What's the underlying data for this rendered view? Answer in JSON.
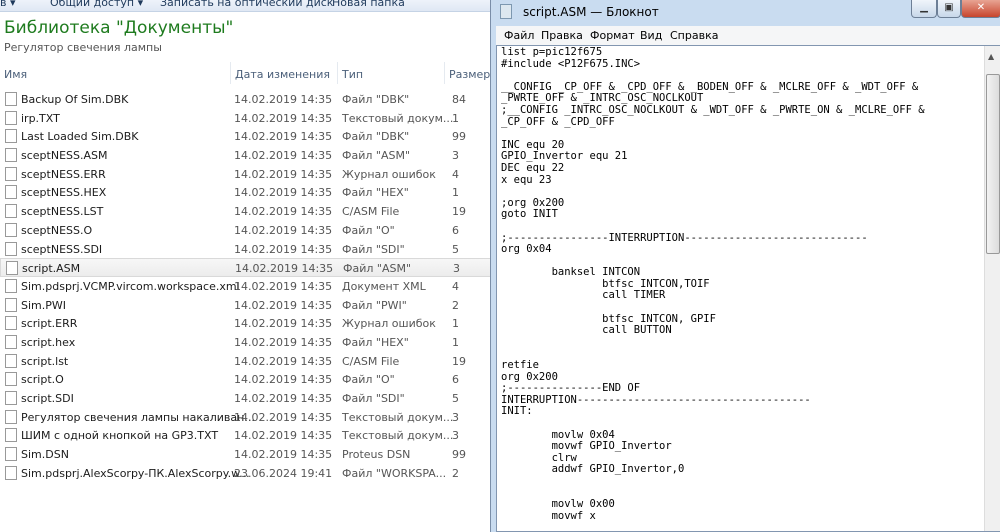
{
  "explorer": {
    "toolbar": [
      "в ▾",
      "Общий доступ ▾",
      "Записать на оптический диск",
      "Новая папка"
    ],
    "library_title": "Библиотека \"Документы\"",
    "subtitle": "Регулятор свечения лампы",
    "columns": {
      "name": "Имя",
      "date": "Дата изменения",
      "type": "Тип",
      "size": "Размер"
    },
    "files": [
      {
        "name": "Backup Of Sim.DBK",
        "date": "14.02.2019 14:35",
        "type": "Файл \"DBK\"",
        "size": "84",
        "icon": "file-icon"
      },
      {
        "name": "irp.TXT",
        "date": "14.02.2019 14:35",
        "type": "Текстовый докум...",
        "size": "1",
        "icon": "text-file-icon"
      },
      {
        "name": "Last Loaded Sim.DBK",
        "date": "14.02.2019 14:35",
        "type": "Файл \"DBK\"",
        "size": "99",
        "icon": "file-icon"
      },
      {
        "name": "sceptNESS.ASM",
        "date": "14.02.2019 14:35",
        "type": "Файл \"ASM\"",
        "size": "3",
        "icon": "text-file-icon"
      },
      {
        "name": "sceptNESS.ERR",
        "date": "14.02.2019 14:35",
        "type": "Журнал ошибок",
        "size": "4",
        "icon": "log-file-icon"
      },
      {
        "name": "sceptNESS.HEX",
        "date": "14.02.2019 14:35",
        "type": "Файл \"HEX\"",
        "size": "1",
        "icon": "hex-file-icon"
      },
      {
        "name": "sceptNESS.LST",
        "date": "14.02.2019 14:35",
        "type": "C/ASM File",
        "size": "19",
        "icon": "gear-file-icon"
      },
      {
        "name": "sceptNESS.O",
        "date": "14.02.2019 14:35",
        "type": "Файл \"O\"",
        "size": "6",
        "icon": "file-icon"
      },
      {
        "name": "sceptNESS.SDI",
        "date": "14.02.2019 14:35",
        "type": "Файл \"SDI\"",
        "size": "5",
        "icon": "file-icon"
      },
      {
        "name": "script.ASM",
        "date": "14.02.2019 14:35",
        "type": "Файл \"ASM\"",
        "size": "3",
        "icon": "text-file-icon",
        "selected": true
      },
      {
        "name": "Sim.pdsprj.VCMP.vircom.workspace.xml",
        "date": "14.02.2019 14:35",
        "type": "Документ XML",
        "size": "4",
        "icon": "xml-file-icon"
      },
      {
        "name": "Sim.PWI",
        "date": "14.02.2019 14:35",
        "type": "Файл \"PWI\"",
        "size": "2",
        "icon": "file-icon"
      },
      {
        "name": "script.ERR",
        "date": "14.02.2019 14:35",
        "type": "Журнал ошибок",
        "size": "1",
        "icon": "log-file-icon"
      },
      {
        "name": "script.hex",
        "date": "14.02.2019 14:35",
        "type": "Файл \"HEX\"",
        "size": "1",
        "icon": "hex-file-icon"
      },
      {
        "name": "script.lst",
        "date": "14.02.2019 14:35",
        "type": "C/ASM File",
        "size": "19",
        "icon": "gear-file-icon"
      },
      {
        "name": "script.O",
        "date": "14.02.2019 14:35",
        "type": "Файл \"O\"",
        "size": "6",
        "icon": "file-icon"
      },
      {
        "name": "script.SDI",
        "date": "14.02.2019 14:35",
        "type": "Файл \"SDI\"",
        "size": "5",
        "icon": "file-icon"
      },
      {
        "name": "Регулятор свечения лампы накаливан...",
        "date": "14.02.2019 14:35",
        "type": "Текстовый докум...",
        "size": "3",
        "icon": "text-file-icon"
      },
      {
        "name": "ШИМ с одной кнопкой на GP3.TXT",
        "date": "14.02.2019 14:35",
        "type": "Текстовый докум...",
        "size": "3",
        "icon": "text-file-icon"
      },
      {
        "name": "Sim.DSN",
        "date": "14.02.2019 14:35",
        "type": "Proteus DSN",
        "size": "99",
        "icon": "proteus-icon"
      },
      {
        "name": "Sim.pdsprj.AlexScorpy-ПК.AlexScorpy.w...",
        "date": "23.06.2024 19:41",
        "type": "Файл \"WORKSPA...",
        "size": "2",
        "icon": "file-icon"
      }
    ]
  },
  "notepad": {
    "title": "script.ASM — Блокнот",
    "menu": [
      "Файл",
      "Правка",
      "Формат",
      "Вид",
      "Справка"
    ],
    "code": [
      "list p=pic12f675",
      "#include <P12F675.INC>",
      "",
      "__CONFIG _CP_OFF & _CPD_OFF & _BODEN_OFF & _MCLRE_OFF & _WDT_OFF &",
      "_PWRTE_OFF & _INTRC_OSC_NOCLKOUT",
      ";__CONFIG _INTRC_OSC_NOCLKOUT & _WDT_OFF & _PWRTE_ON & _MCLRE_OFF &",
      "_CP_OFF & _CPD_OFF",
      "",
      "INC equ 20",
      "GPIO_Invertor equ 21",
      "DEC equ 22",
      "x equ 23",
      "",
      ";org 0x200",
      "goto INIT",
      "",
      ";----------------INTERRUPTION-----------------------------",
      "org 0x04",
      "",
      "        banksel INTCON",
      "                btfsc INTCON,TOIF",
      "                call TIMER",
      "",
      "                btfsc INTCON, GPIF",
      "                call BUTTON",
      "",
      "",
      "retfie",
      "org 0x200",
      ";---------------END OF",
      "INTERRUPTION-------------------------------------",
      "INIT:",
      "",
      "        movlw 0x04",
      "        movwf GPIO_Invertor",
      "        clrw",
      "        addwf GPIO_Invertor,0",
      "",
      "",
      "        movlw 0x00",
      "        movwf x"
    ]
  }
}
